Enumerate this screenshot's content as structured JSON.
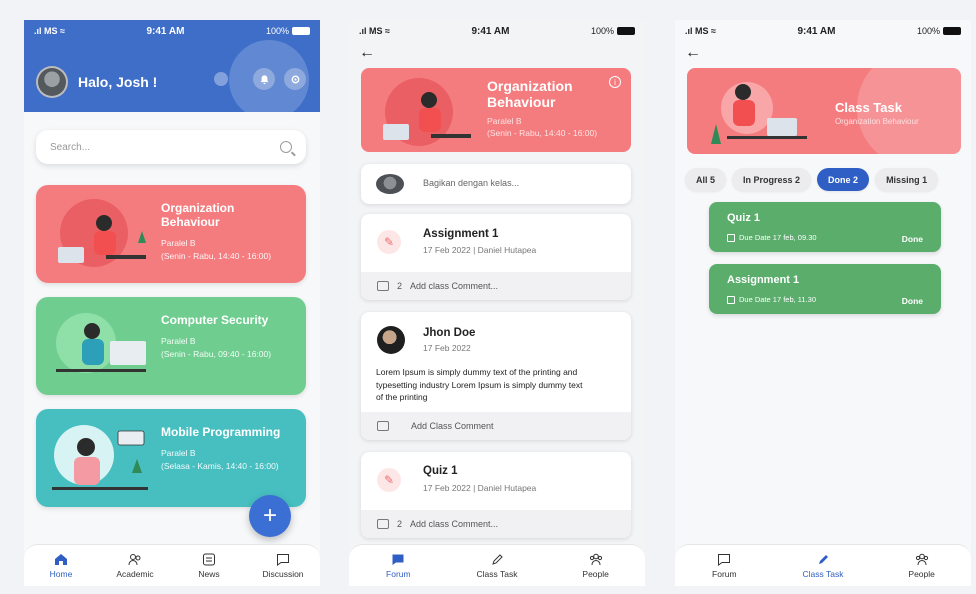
{
  "status": {
    "carrier": "MS",
    "time": "9:41 AM",
    "battery": "100%"
  },
  "home": {
    "greeting": "Halo, Josh !",
    "search_placeholder": "Search...",
    "courses": [
      {
        "title": "Organization Behaviour",
        "class": "Paralel B",
        "schedule": "(Senin - Rabu, 14:40 - 16:00)",
        "color": "#f47c7f"
      },
      {
        "title": "Computer Security",
        "class": "Paralel B",
        "schedule": "(Senin - Rabu, 09:40 - 16:00)",
        "color": "#6fce8f"
      },
      {
        "title": "Mobile Programming",
        "class": "Paralel B",
        "schedule": "(Selasa - Kamis, 14:40 - 16:00)",
        "color": "#47bfc1"
      }
    ],
    "fab": "+",
    "nav": [
      "Home",
      "Academic",
      "News",
      "Discussion"
    ]
  },
  "forum": {
    "course_title": "Organization Behaviour",
    "course_class": "Paralel B",
    "course_schedule": "(Senin - Rabu, 14:40 - 16:00)",
    "share_placeholder": "Bagikan dengan kelas...",
    "assignment": {
      "title": "Assignment 1",
      "meta": "17 Feb 2022 | Daniel Hutapea",
      "comment_count": "2",
      "comment_label": "Add class Comment..."
    },
    "post": {
      "author": "Jhon Doe",
      "date": "17 Feb 2022",
      "body": "Lorem Ipsum is simply dummy text of the printing and typesetting industry Lorem Ipsum is simply dummy text of the printing",
      "comment_label": "Add Class Comment"
    },
    "quiz": {
      "title": "Quiz 1",
      "meta": "17 Feb 2022 | Daniel Hutapea",
      "comment_count": "2",
      "comment_label": "Add class Comment..."
    },
    "nav": [
      "Forum",
      "Class Task",
      "People"
    ]
  },
  "task": {
    "title": "Class Task",
    "subtitle": "Organization Behaviour",
    "filters": [
      "All 5",
      "In Progress 2",
      "Done 2",
      "Missing 1"
    ],
    "active_filter": "Done 2",
    "items": [
      {
        "name": "Quiz 1",
        "due": "Due Date 17 feb, 09.30",
        "status": "Done"
      },
      {
        "name": "Assignment 1",
        "due": "Due Date 17 feb, 11.30",
        "status": "Done"
      }
    ],
    "nav": [
      "Forum",
      "Class Task",
      "People"
    ]
  },
  "icons": [
    "home-icon",
    "academic-icon",
    "news-icon",
    "discussion-icon",
    "bell-icon",
    "gear-icon",
    "search-icon",
    "back-arrow-icon",
    "pencil-icon",
    "comment-icon",
    "calendar-icon",
    "forum-icon",
    "class-task-icon",
    "people-icon",
    "info-icon",
    "plus-icon"
  ]
}
